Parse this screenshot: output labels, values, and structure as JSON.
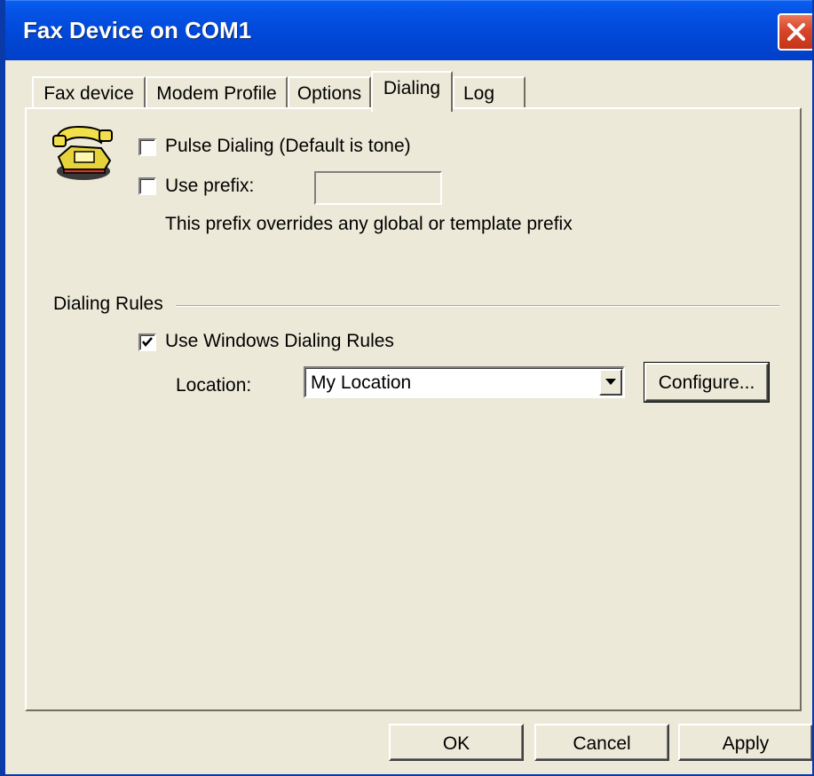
{
  "window": {
    "title": "Fax Device on COM1"
  },
  "tabs": [
    {
      "label": "Fax device",
      "active": false
    },
    {
      "label": "Modem Profile",
      "active": false
    },
    {
      "label": "Options",
      "active": false
    },
    {
      "label": "Dialing",
      "active": true
    },
    {
      "label": "Log",
      "active": false
    }
  ],
  "dialing": {
    "pulse_dialing": {
      "label": "Pulse Dialing (Default is tone)",
      "checked": false
    },
    "use_prefix": {
      "label": "Use prefix:",
      "checked": false,
      "value": ""
    },
    "prefix_note": "This prefix overrides any global or template prefix",
    "rules_group_label": "Dialing Rules",
    "use_windows_rules": {
      "label": "Use Windows Dialing Rules",
      "checked": true
    },
    "location_label": "Location:",
    "location_value": "My Location",
    "configure_label": "Configure..."
  },
  "footer": {
    "ok_label": "OK",
    "cancel_label": "Cancel",
    "apply_label": "Apply"
  },
  "icons": {
    "phone": "telephone-icon",
    "close": "close-icon",
    "dropdown": "chevron-down-icon"
  },
  "colors": {
    "titlebar": "#0148d8",
    "dialog_bg": "#ece9d8",
    "close_button": "#d8452a"
  }
}
